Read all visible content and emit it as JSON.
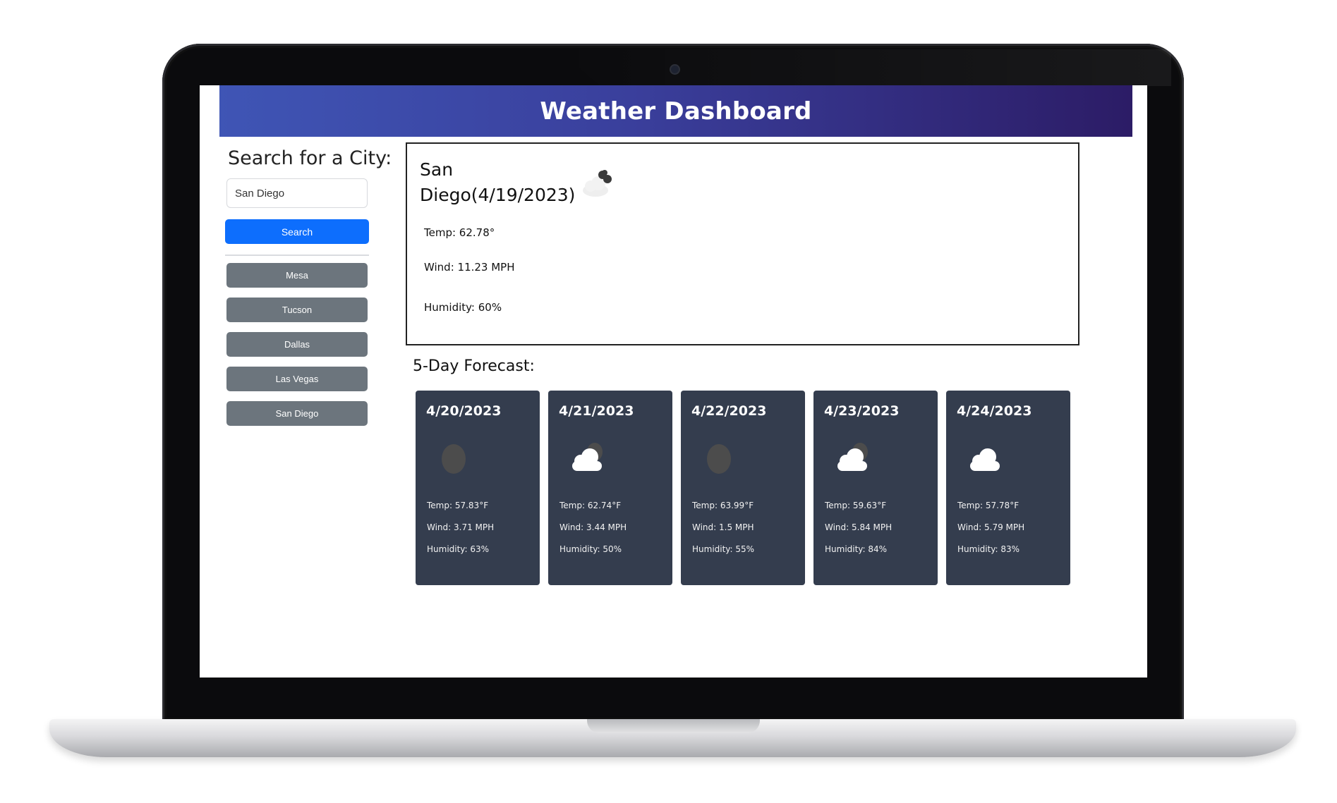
{
  "app": {
    "title": "Weather Dashboard"
  },
  "sidebar": {
    "heading": "Search for a City:",
    "search_value": "San Diego",
    "search_button": "Search",
    "history": [
      "Mesa",
      "Tucson",
      "Dallas",
      "Las Vegas",
      "San Diego"
    ]
  },
  "current": {
    "city_line1": "San",
    "city_line2": "Diego(4/19/2023)",
    "icon": "cloud-night-icon",
    "temp": "Temp: 62.78°",
    "wind": "Wind: 11.23 MPH",
    "humidity": "Humidity: 60%"
  },
  "forecast": {
    "title": "5-Day Forecast:",
    "days": [
      {
        "date": "4/20/2023",
        "icon": "moon-icon",
        "temp": "Temp: 57.83°F",
        "wind": "Wind: 3.71 MPH",
        "humidity": "Humidity: 63%"
      },
      {
        "date": "4/21/2023",
        "icon": "cloud-icon",
        "temp": "Temp: 62.74°F",
        "wind": "Wind: 3.44 MPH",
        "humidity": "Humidity: 50%"
      },
      {
        "date": "4/22/2023",
        "icon": "moon-icon",
        "temp": "Temp: 63.99°F",
        "wind": "Wind: 1.5 MPH",
        "humidity": "Humidity: 55%"
      },
      {
        "date": "4/23/2023",
        "icon": "cloud-icon",
        "temp": "Temp: 59.63°F",
        "wind": "Wind: 5.84 MPH",
        "humidity": "Humidity: 84%"
      },
      {
        "date": "4/24/2023",
        "icon": "cloud-icon",
        "temp": "Temp: 57.78°F",
        "wind": "Wind: 5.79 MPH",
        "humidity": "Humidity: 83%"
      }
    ]
  },
  "colors": {
    "header_start": "#3f55b5",
    "header_end": "#2c1c66",
    "search_button": "#0d6efd",
    "history_button": "#6c757d",
    "forecast_card": "#343d4e"
  }
}
